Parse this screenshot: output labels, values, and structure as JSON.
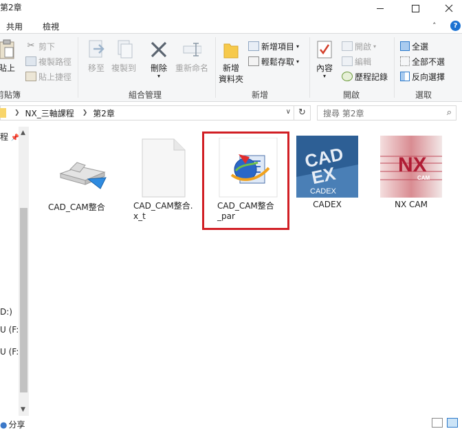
{
  "window": {
    "title": "第2章"
  },
  "ribbon_tabs": {
    "share": "共用",
    "view": "檢視"
  },
  "ribbon": {
    "clipboard": {
      "paste": "貼上",
      "cut": "剪下",
      "copy_path": "複製路徑",
      "paste_shortcut": "貼上捷徑",
      "group": "剪貼簿"
    },
    "organize": {
      "move_to": "移至",
      "copy_to": "複製到",
      "delete": "刪除",
      "rename": "重新命名",
      "group": "組合管理"
    },
    "new": {
      "new_folder_line1": "新增",
      "new_folder_line2": "資料夾",
      "new_item": "新增項目",
      "easy_access": "輕鬆存取",
      "group": "新增"
    },
    "open": {
      "properties": "內容",
      "open": "開啟",
      "edit": "編輯",
      "history": "歷程記錄",
      "group": "開啟"
    },
    "select": {
      "select_all": "全選",
      "select_none": "全部不選",
      "invert": "反向選擇",
      "group": "選取"
    }
  },
  "address": {
    "crumbs": [
      "NX_三軸課程",
      "第2章"
    ],
    "search_placeholder": "搜尋 第2章"
  },
  "nav": {
    "items": [
      "程",
      "D:)",
      "U (F:",
      "U (F:)"
    ]
  },
  "files": [
    {
      "name": "CAD_CAM整合",
      "icon": "nx-part-icon"
    },
    {
      "name": "CAD_CAM整合.x_t",
      "icon": "blank-file-icon"
    },
    {
      "name": "CAD_CAM整合_par",
      "icon": "globe-document-icon",
      "selected": true
    },
    {
      "name": "CADEX",
      "icon": "cadex-logo-icon"
    },
    {
      "name": "NX CAM",
      "icon": "nx-cam-logo-icon"
    }
  ],
  "logos": {
    "cadex_small": "CADEX",
    "nx_big": "NX",
    "nx_small": "CAM"
  },
  "status": {
    "share": "分享"
  }
}
